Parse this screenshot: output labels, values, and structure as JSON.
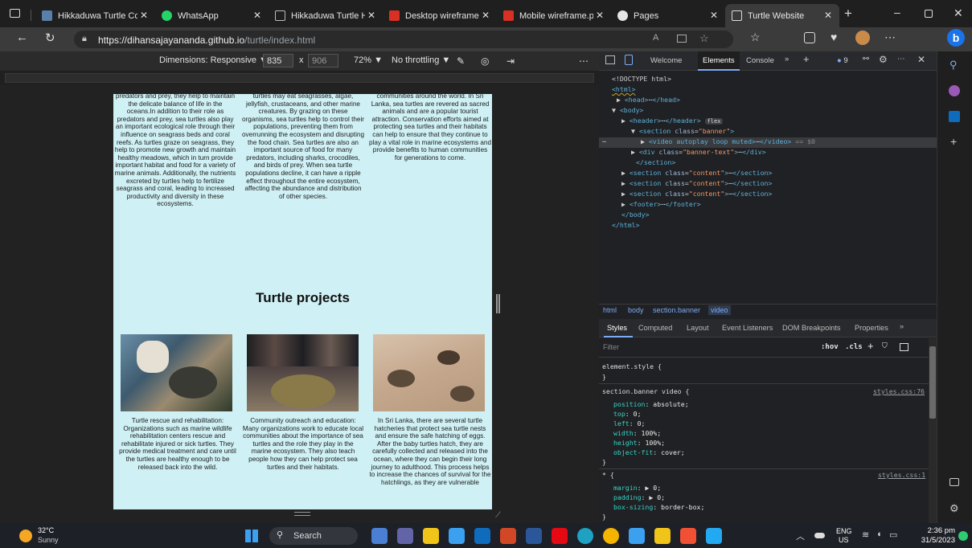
{
  "tabs": [
    {
      "label": "Hikkaduwa Turtle Con",
      "icon": "page-icon",
      "color": "#5a7fa8",
      "active": false
    },
    {
      "label": "WhatsApp",
      "icon": "whatsapp-icon",
      "color": "#25d366",
      "active": false
    },
    {
      "label": "Hikkaduwa Turtle Hat",
      "icon": "document-icon",
      "color": "#9aa0a6",
      "active": false
    },
    {
      "label": "Desktop wireframe.pd",
      "icon": "pdf-icon",
      "color": "#d93025",
      "active": false
    },
    {
      "label": "Mobile wireframe.pdf",
      "icon": "pdf-icon",
      "color": "#d93025",
      "active": false
    },
    {
      "label": "Pages",
      "icon": "github-icon",
      "color": "#e6e6e6",
      "active": false
    },
    {
      "label": "Turtle Website",
      "icon": "document-icon",
      "color": "#e6e6e6",
      "active": true
    }
  ],
  "address": {
    "url_host": "https://dihansajayananda.github.io",
    "url_path": "/turtle/index.html"
  },
  "device_toolbar": {
    "dimensions_label": "Dimensions: Responsive",
    "width": "835",
    "times": "x",
    "height": "906",
    "zoom": "72%",
    "throttle": "No throttling"
  },
  "page": {
    "col1": "predators and prey, they help to maintain the delicate balance of life in the oceans.In addition to their role as predators and prey, sea turtles also play an important ecological role through their influence on seagrass beds and coral reefs. As turtles graze on seagrass, they help to promote new growth and maintain healthy meadows, which in turn provide important habitat and food for a variety of marine animals. Additionally, the nutrients excreted by turtles help to fertilize seagrass and coral, leading to increased productivity and diversity in these ecosystems.",
    "col2": "turtles may eat seagrasses, algae, jellyfish, crustaceans, and other marine creatures. By grazing on these organisms, sea turtles help to control their populations, preventing them from overrunning the ecosystem and disrupting the food chain. Sea turtles are also an important source of food for many predators, including sharks, crocodiles, and birds of prey. When sea turtle populations decline, it can have a ripple effect throughout the entire ecosystem, affecting the abundance and distribution of other species.",
    "col3": "communities around the world. In Sri Lanka, sea turtles are revered as sacred animals and are a popular tourist attraction. Conservation efforts aimed at protecting sea turtles and their habitats can help to ensure that they continue to play a vital role in marine ecosystems and provide benefits to human communities for generations to come.",
    "projects_title": "Turtle projects",
    "project1": "Turtle rescue and rehabilitation: Organizations such as marine wildlife rehabilitation centers rescue and rehabilitate injured or sick turtles. They provide medical treatment and care until the turtles are healthy enough to be released back into the wild.",
    "project2": "Community outreach and education: Many organizations work to educate local communities about the importance of sea turtles and the role they play in the marine ecosystem. They also teach people how they can help protect sea turtles and their habitats.",
    "project3": "In Sri Lanka, there are several turtle hatcheries that protect sea turtle nests and ensure the safe hatching of eggs. After the baby turtles hatch, they are carefully collected and released into the ocean, where they can begin their long journey to adulthood. This process helps to increase the chances of survival for the hatchlings, as they are vulnerable"
  },
  "devtools": {
    "tabs": {
      "welcome": "Welcome",
      "elements": "Elements",
      "console": "Console"
    },
    "badge_count": "9",
    "dom": {
      "doctype": "<!DOCTYPE html>",
      "html_open": "<html>",
      "head": "head",
      "body": "body",
      "header": "header",
      "flex_badge": "flex",
      "section_banner_attr": "class",
      "section_banner_val": "\"banner\"",
      "video_line": "video autoplay loop muted",
      "video_eq": "== $0",
      "div_banner": "\"banner-text\"",
      "section_content": "\"content\"",
      "footer": "footer"
    },
    "breadcrumb": [
      "html",
      "body",
      "section.banner",
      "video"
    ],
    "style_tabs": [
      "Styles",
      "Computed",
      "Layout",
      "Event Listeners",
      "DOM Breakpoints",
      "Properties"
    ],
    "filter_placeholder": "Filter",
    "hov": ":hov",
    "cls": ".cls",
    "element_style": "element.style {",
    "rule1_selector": "section.banner video {",
    "rule1_source": "styles.css:76",
    "rule1_props": [
      {
        "name": "position",
        "value": "absolute;"
      },
      {
        "name": "top",
        "value": "0;"
      },
      {
        "name": "left",
        "value": "0;"
      },
      {
        "name": "width",
        "value": "100%;"
      },
      {
        "name": "height",
        "value": "100%;"
      },
      {
        "name": "object-fit",
        "value": "cover;"
      }
    ],
    "rule2_selector": "* {",
    "rule2_source": "styles.css:1",
    "rule2_props": [
      {
        "name": "margin",
        "value": "0;"
      },
      {
        "name": "padding",
        "value": "0;"
      },
      {
        "name": "box-sizing",
        "value": "border-box;"
      }
    ]
  },
  "taskbar": {
    "temp": "32°C",
    "weather": "Sunny",
    "search": "Search",
    "lang1": "ENG",
    "lang2": "US",
    "time": "2:36 pm",
    "date": "31/5/2023"
  }
}
